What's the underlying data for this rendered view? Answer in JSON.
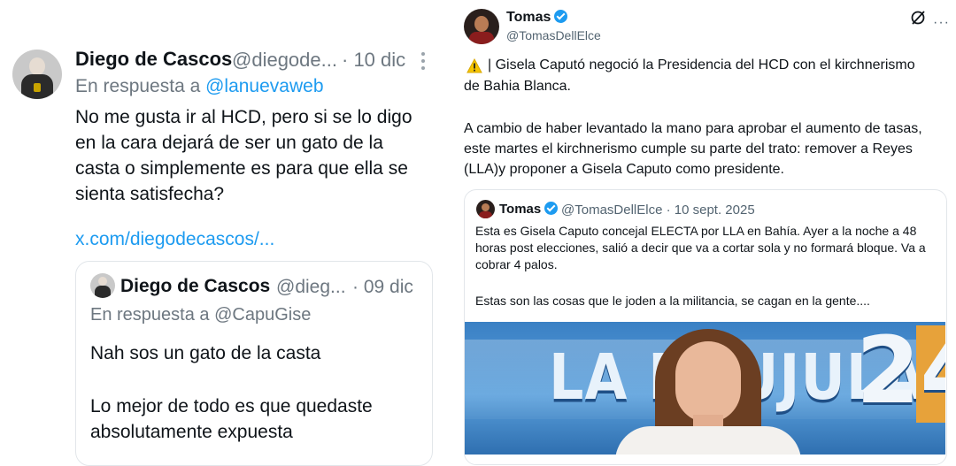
{
  "left_tweet": {
    "author_name": "Diego de Cascos",
    "handle": "@diegode...",
    "time": "· 10 dic",
    "reply_prefix": "En respuesta a ",
    "reply_to": "@lanuevaweb",
    "text": "No me gusta ir al HCD, pero si se lo digo en la cara dejará de ser un gato de la casta o simplemente es para que ella se sienta satisfecha?",
    "link": "x.com/diegodecascos/...",
    "quoted": {
      "author_name": "Diego de Cascos",
      "handle": "@dieg...",
      "time": "· 09 dic",
      "reply_line": "En respuesta a @CapuGise",
      "text1": "Nah sos un gato de la casta",
      "text2": "Lo mejor de todo es que quedaste absolutamente expuesta"
    }
  },
  "right_tweet": {
    "author_name": "Tomas",
    "handle": "@TomasDellElce",
    "more_label": "···",
    "text_line1": "| Gisela Caputó negoció la Presidencia del HCD con el kirchnerismo",
    "text_line1b": "de Bahia Blanca.",
    "text_para2": "A cambio de haber levantado la mano para aprobar el aumento de tasas, este martes el kirchnerismo cumple su parte del trato: remover a Reyes (LLA)y proponer a Gisela Caputo como presidente.",
    "quoted": {
      "author_name": "Tomas",
      "handle_time": "@TomasDellElce · 10 sept. 2025",
      "text": "Esta es Gisela Caputo concejal ELECTA por LLA en Bahía. Ayer a la noche a 48 horas post elecciones, salió a decir que va a cortar sola y no formará bloque. Va a cobrar 4 palos.",
      "text2": "Estas son las cosas que le joden a la militancia, se cagan en la gente....",
      "image_brand_text": "LA BRUJULA",
      "image_number": "24"
    }
  },
  "colors": {
    "link_blue": "#1d9bf0",
    "muted_gray": "#6d7780",
    "verified_blue": "#1d9bf0",
    "warning_yellow": "#f5c400"
  }
}
